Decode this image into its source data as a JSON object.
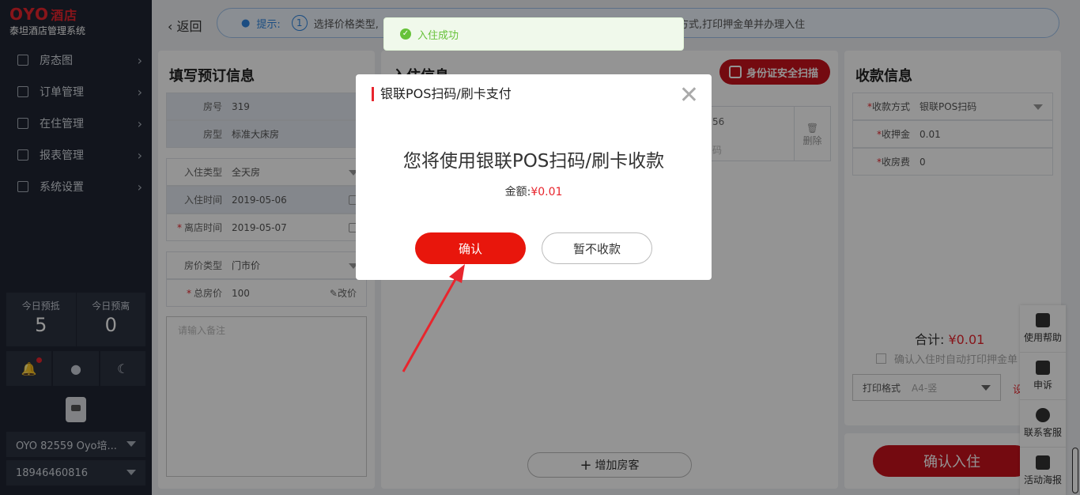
{
  "sidebar": {
    "logo": "OYO",
    "logo_hotel": "酒店",
    "subtitle": "泰坦酒店管理系统",
    "menu": [
      {
        "label": "房态图",
        "icon": "grid-icon"
      },
      {
        "label": "订单管理",
        "icon": "document-icon"
      },
      {
        "label": "在住管理",
        "icon": "bed-icon"
      },
      {
        "label": "报表管理",
        "icon": "chart-icon"
      },
      {
        "label": "系统设置",
        "icon": "monitor-icon"
      }
    ],
    "stats": [
      {
        "label": "今日预抵",
        "value": "5"
      },
      {
        "label": "今日预离",
        "value": "0"
      }
    ],
    "hotel_select": "OYO 82559 Oyo培...",
    "phone_select": "18946460816"
  },
  "header": {
    "back_label": "返回",
    "tip_label": "提示:",
    "tip_step": "1",
    "tip_text": "选择价格类型,",
    "tip_text_end": "入金额,选择收款方式,打印押金单并办理入住"
  },
  "booking": {
    "title": "填写预订信息",
    "room_no_label": "房号",
    "room_no": "319",
    "room_type_label": "房型",
    "room_type": "标准大床房",
    "checkin_type_label": "入住类型",
    "checkin_type": "全天房",
    "checkin_time_label": "入住时间",
    "checkin_time": "2019-05-06",
    "checkout_time_label": "离店时间",
    "checkout_time": "2019-05-07",
    "price_type_label": "房价类型",
    "price_type": "门市价",
    "total_price_label": "总房价",
    "total_price": "100",
    "edit_price": "改价",
    "remark_placeholder": "请输入备注"
  },
  "guest": {
    "title": "入住信息",
    "scan_button": "身份证安全扫描",
    "card_value": "56",
    "card_hint": "码",
    "delete_label": "删除",
    "add_guest": "增加房客"
  },
  "payment": {
    "title": "收款信息",
    "method_label": "收款方式",
    "method": "银联POS扫码",
    "deposit_label": "收押金",
    "deposit": "0.01",
    "room_fee_label": "收房费",
    "room_fee": "0",
    "total_label": "合计:",
    "total_amount": "¥0.01",
    "auto_print": "确认入住时自动打印押金单",
    "print_format_label": "打印格式",
    "print_format": "A4-竖",
    "settings_link": "设",
    "confirm_checkin": "确认入住"
  },
  "float_bar": [
    {
      "label": "使用帮助",
      "icon": "book-icon"
    },
    {
      "label": "申诉",
      "icon": "gavel-icon"
    },
    {
      "label": "联系客服",
      "icon": "headset-icon"
    },
    {
      "label": "活动海报",
      "icon": "qrcode-icon"
    }
  ],
  "toast": "入住成功",
  "modal": {
    "title": "银联POS扫码/刷卡支付",
    "message": "您将使用银联POS扫码/刷卡收款",
    "amount_label": "金额:",
    "amount": "¥0.01",
    "confirm": "确认",
    "cancel": "暂不收款"
  },
  "colors": {
    "brand": "#e8252d",
    "sidebar": "#1f2532",
    "confirm": "#e8160c",
    "success": "#67c23a"
  }
}
